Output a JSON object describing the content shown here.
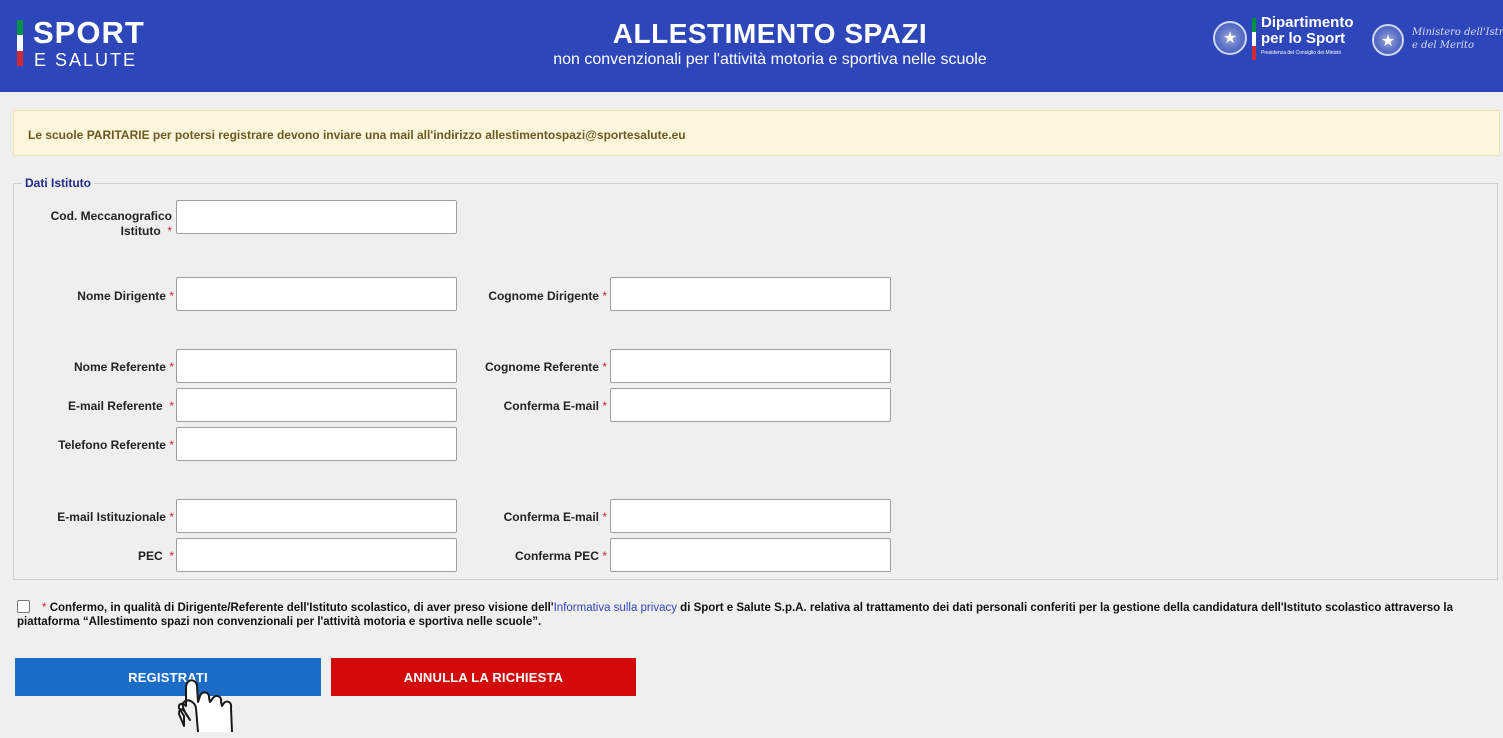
{
  "header": {
    "logo_line1": "SPORT",
    "logo_line2": "E SALUTE",
    "title": "ALLESTIMENTO SPAZI",
    "subtitle": "non convenzionali per l'attività motoria e sportiva nelle scuole",
    "dept_line1": "Dipartimento",
    "dept_line2": "per lo Sport",
    "dept_line3": "Presidenza del Consiglio dei Ministri",
    "ministry_line1": "Ministero dell'Istruzione",
    "ministry_line2": "e del Merito"
  },
  "notice": "Le scuole PARITARIE per potersi registrare devono inviare una mail all'indirizzo allestimentospazi@sportesalute.eu",
  "form": {
    "legend": "Dati Istituto",
    "required_mark": "*",
    "fields": {
      "cod_line1": "Cod. Meccanografico",
      "cod_line2": "Istituto",
      "nome_dirigente": "Nome Dirigente",
      "cognome_dirigente": "Cognome Dirigente",
      "nome_referente": "Nome Referente",
      "cognome_referente": "Cognome Referente",
      "email_referente": "E-mail Referente",
      "conferma_email_ref": "Conferma E-mail",
      "telefono_referente": "Telefono Referente",
      "email_istituzionale": "E-mail Istituzionale",
      "conferma_email_ist": "Conferma E-mail",
      "pec": "PEC",
      "conferma_pec": "Conferma PEC"
    },
    "values": {
      "cod": "",
      "nome_dirigente": "",
      "cognome_dirigente": "",
      "nome_referente": "",
      "cognome_referente": "",
      "email_referente": "",
      "conferma_email_ref": "",
      "telefono_referente": "",
      "email_istituzionale": "",
      "conferma_email_ist": "",
      "pec": "",
      "conferma_pec": ""
    }
  },
  "consent": {
    "required_mark": "*",
    "text_before": "Confermo, in qualità di Dirigente/Referente dell'Istituto scolastico, di aver preso visione dell'",
    "link": "Informativa sulla privacy",
    "text_after": " di Sport e Salute S.p.A. relativa al trattamento dei dati personali conferiti per la gestione della candidatura dell'Istituto scolastico attraverso la piattaforma “Allestimento spazi non convenzionali per l'attività motoria e sportiva nelle scuole”.",
    "checked": false
  },
  "buttons": {
    "register": "REGISTRATI",
    "cancel": "ANNULLA LA RICHIESTA"
  },
  "colors": {
    "header": "#2d46b9",
    "register": "#1b6dc8",
    "cancel": "#d20a0a",
    "required": "#d2232a"
  },
  "icons": {
    "cursor": "hand-pointer-icon"
  }
}
